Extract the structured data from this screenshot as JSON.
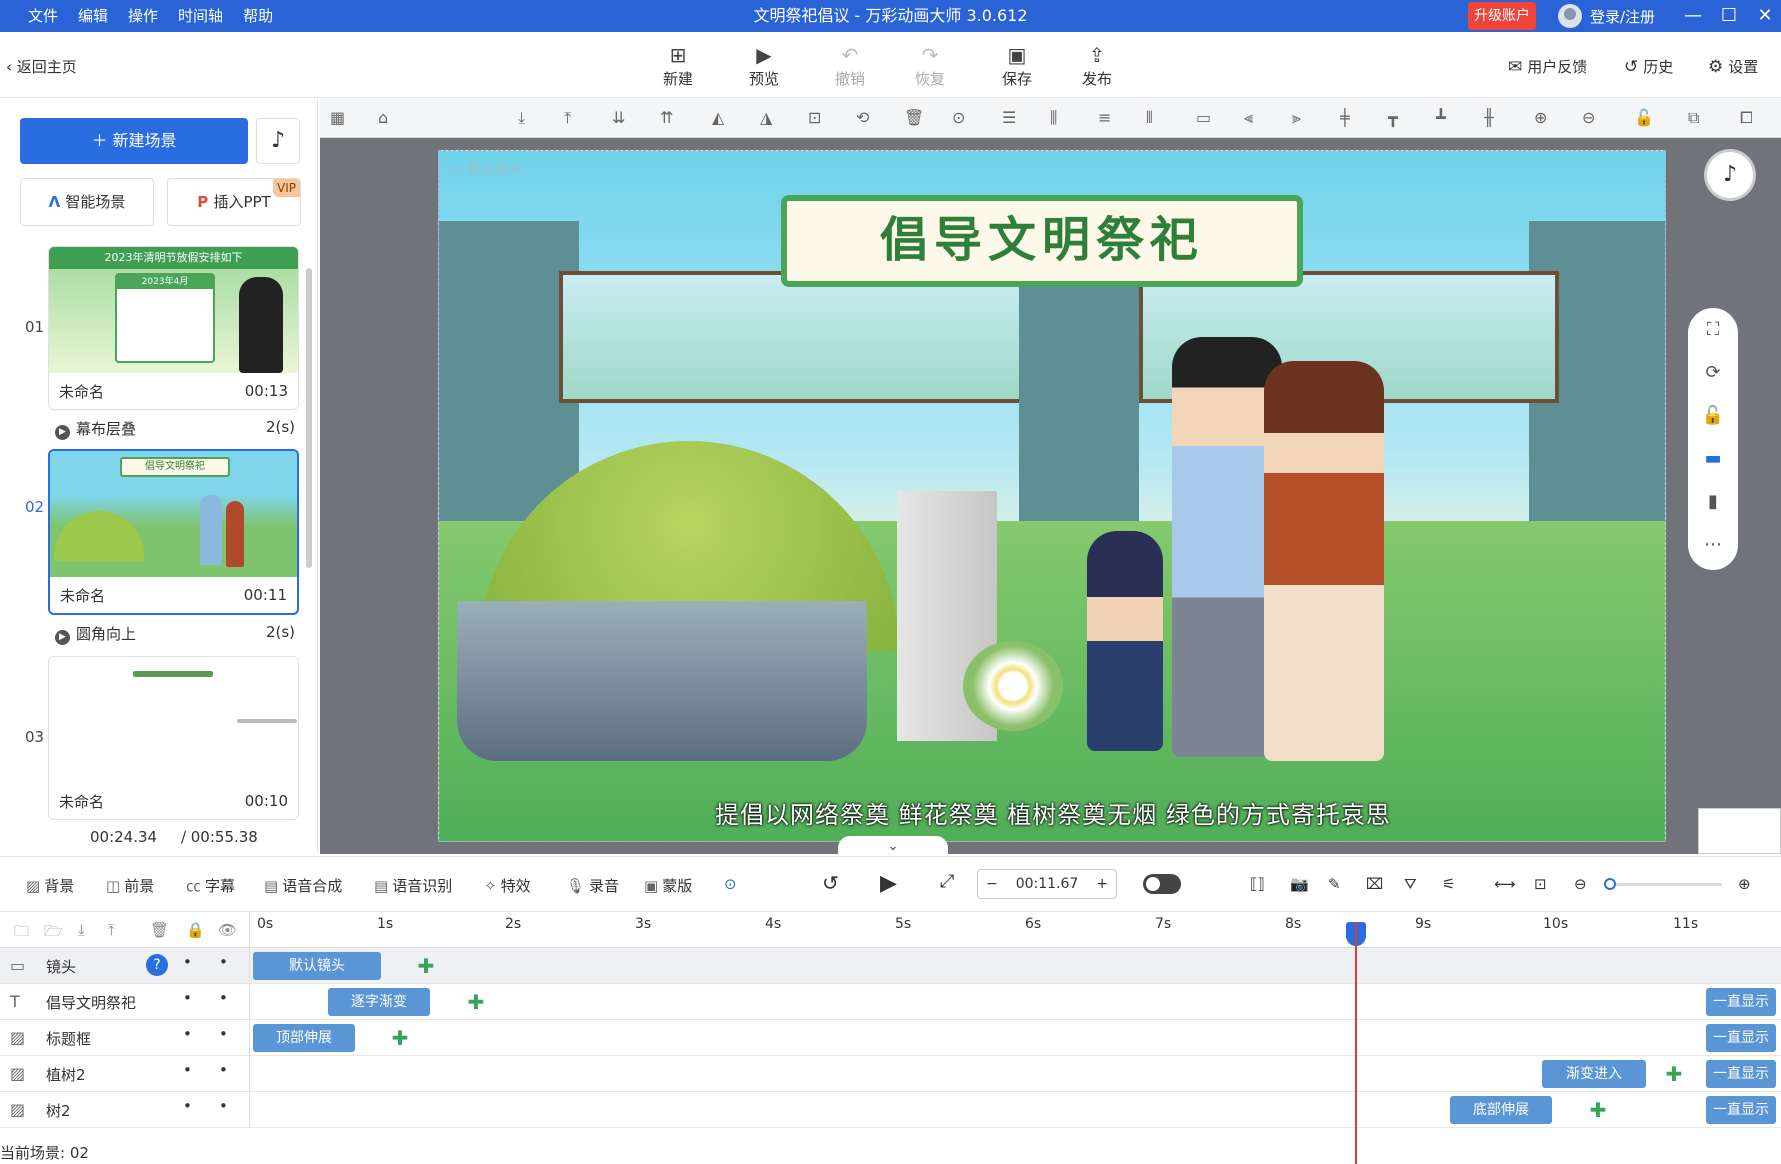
{
  "titlebar": {
    "menu": [
      "文件",
      "编辑",
      "操作",
      "时间轴",
      "帮助"
    ],
    "title": "文明祭祀倡议 - 万彩动画大师 3.0.612",
    "upgrade": "升级账户",
    "login": "登录/注册",
    "controls": [
      "—",
      "☐",
      "✕"
    ]
  },
  "toolbar": {
    "back": "返回主页",
    "buttons": [
      {
        "label": "新建",
        "icon": "plus-square-icon"
      },
      {
        "label": "预览",
        "icon": "play-icon"
      },
      {
        "label": "撤销",
        "icon": "undo-icon"
      },
      {
        "label": "恢复",
        "icon": "redo-icon"
      },
      {
        "label": "保存",
        "icon": "save-icon"
      },
      {
        "label": "发布",
        "icon": "publish-icon"
      }
    ],
    "right": [
      "用户反馈",
      "历史",
      "设置"
    ]
  },
  "left": {
    "new_scene": "新建场景",
    "smart_scene": "智能场景",
    "insert_ppt": "插入PPT",
    "vip": "VIP",
    "scenes": [
      {
        "num": "01",
        "name": "未命名",
        "duration": "00:13",
        "thumb_title": "2023年清明节放假安排如下",
        "thumb_sub": "2023年4月"
      },
      {
        "num": "02",
        "name": "未命名",
        "duration": "00:11",
        "thumb_title": "倡导文明祭祀"
      },
      {
        "num": "03",
        "name": "未命名",
        "duration": "00:10"
      }
    ],
    "transitions": [
      {
        "name": "幕布层叠",
        "duration": "2(s)"
      },
      {
        "name": "圆角向上",
        "duration": "2(s)"
      }
    ],
    "current_time": "00:24.34",
    "total_time": "/ 00:55.38"
  },
  "canvas": {
    "camera_label": "默认镜头",
    "sign_text": "倡导文明祭祀",
    "subtitle": "提倡以网络祭奠 鲜花祭奠 植树祭奠无烟 绿色的方式寄托哀思"
  },
  "timeline_bar": {
    "tools": [
      "背景",
      "前景",
      "字幕",
      "语音合成",
      "语音识别",
      "特效",
      "录音",
      "蒙版"
    ],
    "time": "00:11.67",
    "minus": "−",
    "plus": "+"
  },
  "timeline": {
    "ticks": [
      "0s",
      "1s",
      "2s",
      "3s",
      "4s",
      "5s",
      "6s",
      "7s",
      "8s",
      "9s",
      "10s",
      "11s"
    ],
    "rows": [
      {
        "icon": "camera-icon",
        "name": "镜头",
        "clips": [
          "默认镜头"
        ]
      },
      {
        "icon": "text-icon",
        "name": "倡导文明祭祀",
        "clips": [
          "逐字渐变",
          "一直显示"
        ]
      },
      {
        "icon": "image-icon",
        "name": "标题框",
        "clips": [
          "顶部伸展",
          "一直显示"
        ]
      },
      {
        "icon": "image-icon",
        "name": "植树2",
        "clips": [
          "渐变进入",
          "一直显示"
        ]
      },
      {
        "icon": "image-icon",
        "name": "树2",
        "clips": [
          "底部伸展",
          "一直显示"
        ]
      }
    ],
    "current_scene": "当前场景: 02"
  }
}
